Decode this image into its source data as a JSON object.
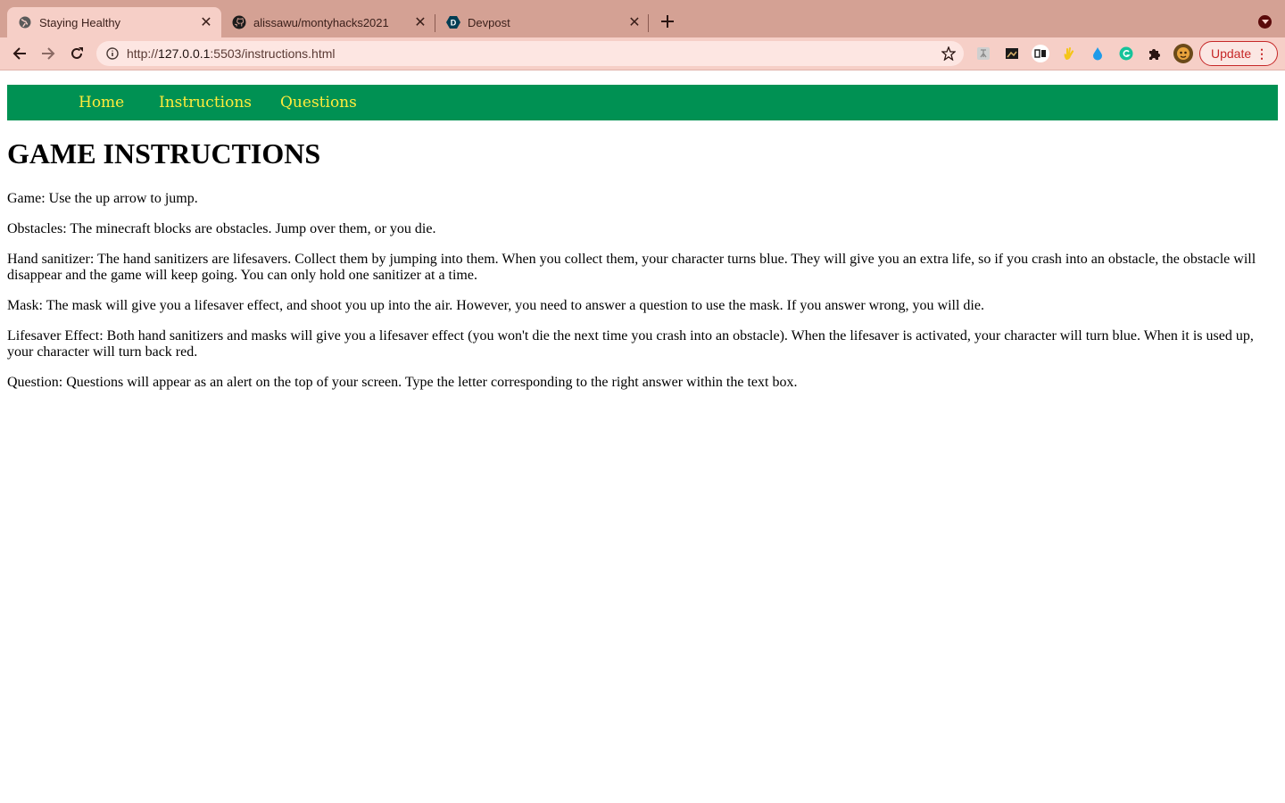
{
  "browser": {
    "tabs": [
      {
        "title": "Staying Healthy",
        "favicon": "globe-icon",
        "active": true
      },
      {
        "title": "alissawu/montyhacks2021",
        "favicon": "github-icon",
        "active": false
      },
      {
        "title": "Devpost",
        "favicon": "devpost-icon",
        "favicon_letter": "D",
        "active": false
      }
    ],
    "url_prefix": "http://",
    "url_host": "127.0.0.1",
    "url_rest": ":5503/instructions.html",
    "update_label": "Update",
    "colors": {
      "tabstrip": "#d4a194",
      "toolbar": "#f6cfc7",
      "update": "#c62828"
    }
  },
  "site": {
    "nav": [
      "Home",
      "Instructions",
      "Questions"
    ],
    "nav_color": "#009153",
    "nav_text_color": "#ffeb3b",
    "title": "GAME INSTRUCTIONS",
    "paragraphs": [
      "Game: Use the up arrow to jump.",
      "Obstacles: The minecraft blocks are obstacles. Jump over them, or you die.",
      "Hand sanitizer: The hand sanitizers are lifesavers. Collect them by jumping into them. When you collect them, your character turns blue. They will give you an extra life, so if you crash into an obstacle, the obstacle will disappear and the game will keep going. You can only hold one sanitizer at a time.",
      "Mask: The mask will give you a lifesaver effect, and shoot you up into the air. However, you need to answer a question to use the mask. If you answer wrong, you will die.",
      "Lifesaver Effect: Both hand sanitizers and masks will give you a lifesaver effect (you won't die the next time you crash into an obstacle). When the lifesaver is activated, your character will turn blue. When it is used up, your character will turn back red.",
      "Question: Questions will appear as an alert on the top of your screen. Type the letter corresponding to the right answer within the text box."
    ]
  }
}
